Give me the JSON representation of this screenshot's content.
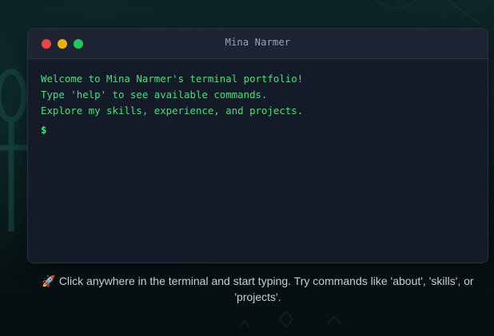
{
  "window": {
    "title": "Mina Narmer"
  },
  "terminal": {
    "lines": [
      "Welcome to Mina Narmer's terminal portfolio!",
      "Type 'help' to see available commands.",
      "Explore my skills, experience, and projects."
    ],
    "prompt": "$",
    "input_value": ""
  },
  "hint": {
    "icon": "🚀",
    "text": "Click anywhere in the terminal and start typing. Try commands like 'about', 'skills', or 'projects'."
  },
  "colors": {
    "terminal_text": "#4ade80",
    "close_dot": "#ef4444",
    "minimize_dot": "#eab308",
    "maximize_dot": "#22c55e"
  }
}
